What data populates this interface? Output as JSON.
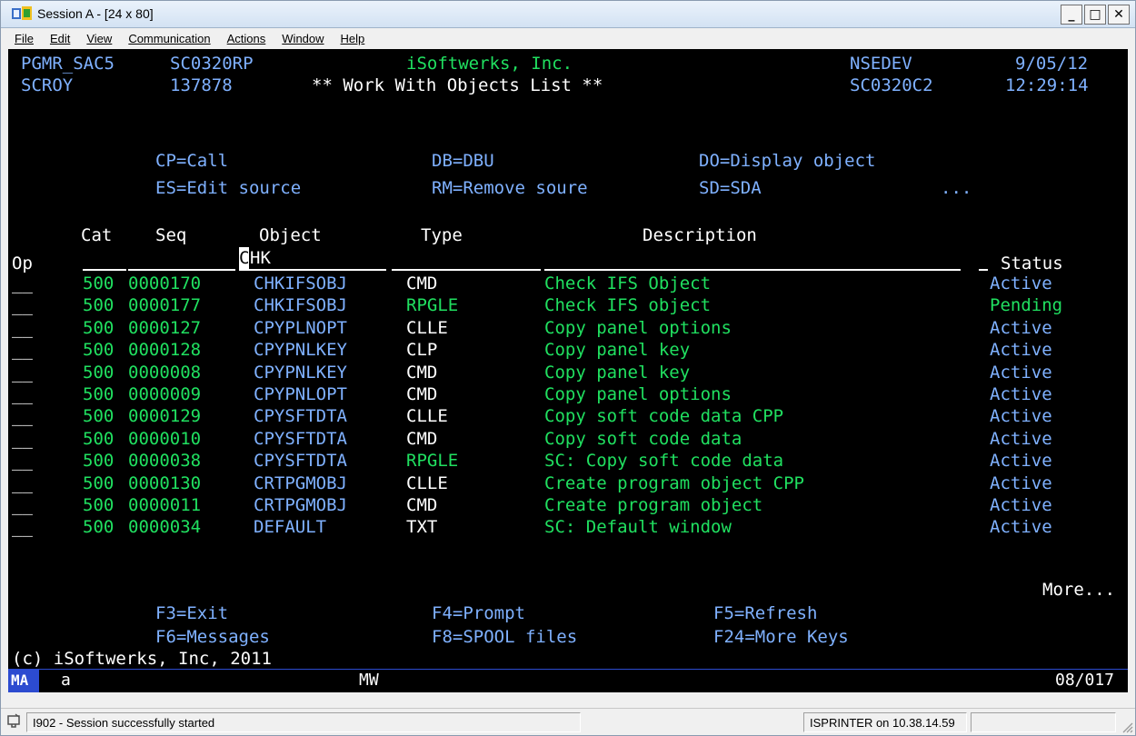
{
  "window": {
    "title": "Session A - [24 x 80]"
  },
  "menu": [
    "File",
    "Edit",
    "View",
    "Communication",
    "Actions",
    "Window",
    "Help"
  ],
  "header": {
    "user": "PGMR_SAC5",
    "program": "SC0320RP",
    "company": "iSoftwerks, Inc.",
    "system": "NSEDEV",
    "date": "9/05/12",
    "user2": "SCROY",
    "job_number": "137878",
    "screen_title": "** Work With Objects List **",
    "display_id": "SC0320C2",
    "time": "12:29:14"
  },
  "options": [
    {
      "code": "CP=Call",
      "desc": ""
    },
    {
      "code": "DB=DBU",
      "desc": ""
    },
    {
      "code": "DO=Display object",
      "desc": ""
    },
    {
      "code": "ES=Edit source",
      "desc": ""
    },
    {
      "code": "RM=Remove soure",
      "desc": ""
    },
    {
      "code": "SD=SDA",
      "desc": ""
    },
    {
      "code": "...",
      "desc": ""
    }
  ],
  "columns": {
    "op": "Op",
    "cat": "Cat",
    "seq": "Seq",
    "object": "Object",
    "type": "Type",
    "description": "Description",
    "status": "Status"
  },
  "filter": {
    "object_value": "CHK",
    "cursor_char": "C"
  },
  "rows": [
    {
      "op": "__",
      "cat": "500",
      "seq": "0000170",
      "object": "CHKIFSOBJ",
      "type": "CMD",
      "description": "Check IFS Object",
      "status": "Active"
    },
    {
      "op": "__",
      "cat": "500",
      "seq": "0000177",
      "object": "CHKIFSOBJ",
      "type": "RPGLE",
      "description": "Check IFS object",
      "status": "Pending"
    },
    {
      "op": "__",
      "cat": "500",
      "seq": "0000127",
      "object": "CPYPLNOPT",
      "type": "CLLE",
      "description": "Copy panel options",
      "status": "Active"
    },
    {
      "op": "__",
      "cat": "500",
      "seq": "0000128",
      "object": "CPYPNLKEY",
      "type": "CLP",
      "description": "Copy panel key",
      "status": "Active"
    },
    {
      "op": "__",
      "cat": "500",
      "seq": "0000008",
      "object": "CPYPNLKEY",
      "type": "CMD",
      "description": "Copy panel key",
      "status": "Active"
    },
    {
      "op": "__",
      "cat": "500",
      "seq": "0000009",
      "object": "CPYPNLOPT",
      "type": "CMD",
      "description": "Copy panel options",
      "status": "Active"
    },
    {
      "op": "__",
      "cat": "500",
      "seq": "0000129",
      "object": "CPYSFTDTA",
      "type": "CLLE",
      "description": "Copy soft code data CPP",
      "status": "Active"
    },
    {
      "op": "__",
      "cat": "500",
      "seq": "0000010",
      "object": "CPYSFTDTA",
      "type": "CMD",
      "description": "Copy soft code data",
      "status": "Active"
    },
    {
      "op": "__",
      "cat": "500",
      "seq": "0000038",
      "object": "CPYSFTDTA",
      "type": "RPGLE",
      "description": "SC: Copy soft code data",
      "status": "Active"
    },
    {
      "op": "__",
      "cat": "500",
      "seq": "0000130",
      "object": "CRTPGMOBJ",
      "type": "CLLE",
      "description": "Create program object CPP",
      "status": "Active"
    },
    {
      "op": "__",
      "cat": "500",
      "seq": "0000011",
      "object": "CRTPGMOBJ",
      "type": "CMD",
      "description": "Create program object",
      "status": "Active"
    },
    {
      "op": "__",
      "cat": "500",
      "seq": "0000034",
      "object": "DEFAULT",
      "type": "TXT",
      "description": "SC: Default window",
      "status": "Active"
    }
  ],
  "more": "More...",
  "fkeys": [
    "F3=Exit",
    "F4=Prompt",
    "F5=Refresh",
    "F6=Messages",
    "F8=SPOOL files",
    "F24=More Keys"
  ],
  "copyright": "(c) iSoftwerks, Inc, 2011",
  "oia": {
    "mode": "MA",
    "indicator": "a",
    "mw": "MW",
    "cursor_pos": "08/017"
  },
  "statusbar": {
    "message": "I902 - Session successfully started",
    "printer": "ISPRINTER on 10.38.14.59"
  },
  "colors": {
    "green": "#20e060",
    "blue": "#7fb1ff",
    "white": "#ffffff",
    "screen_bg": "#000000"
  }
}
